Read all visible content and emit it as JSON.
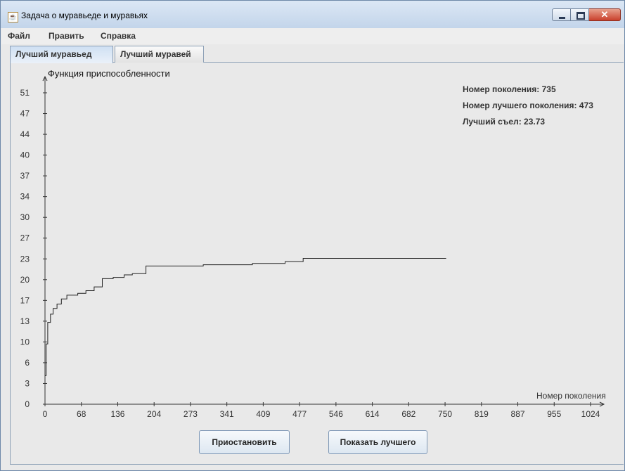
{
  "window": {
    "title": "Задача о муравьеде и муравьях"
  },
  "menu": {
    "items": [
      "Файл",
      "Править",
      "Справка"
    ]
  },
  "tabs": [
    {
      "label": "Лучший муравьед",
      "active": true
    },
    {
      "label": "Лучший муравей",
      "active": false
    }
  ],
  "stats": {
    "generation": "Номер поколения: 735",
    "best_generation": "Номер лучшего поколения: 473",
    "best_eaten": "Лучший съел: 23.73"
  },
  "buttons": {
    "pause": "Приостановить",
    "show_best": "Показать лучшего"
  },
  "chart_data": {
    "type": "line",
    "title": "Функция приспособленности",
    "xlabel": "Номер поколения",
    "ylabel": "",
    "x_ticks": [
      "0",
      "68",
      "136",
      "204",
      "273",
      "341",
      "409",
      "477",
      "546",
      "614",
      "682",
      "750",
      "819",
      "887",
      "955",
      "1024"
    ],
    "y_ticks": [
      "0",
      "3",
      "6",
      "10",
      "13",
      "17",
      "20",
      "23",
      "27",
      "30",
      "34",
      "37",
      "40",
      "44",
      "47",
      "51"
    ],
    "xlim": [
      0,
      1024
    ],
    "ylim": [
      0,
      51
    ],
    "grid": false,
    "series": [
      {
        "name": "",
        "step": true,
        "x": [
          0,
          2,
          5,
          10,
          15,
          22,
          30,
          40,
          60,
          75,
          90,
          105,
          125,
          145,
          160,
          185,
          290,
          380,
          440,
          473,
          735
        ],
        "y": [
          4.5,
          9.5,
          12.9,
          14.2,
          15.1,
          15.8,
          16.6,
          17.2,
          17.5,
          17.9,
          18.5,
          19.8,
          20.0,
          20.4,
          20.6,
          21.8,
          22.0,
          22.2,
          22.5,
          23.0,
          23.0
        ]
      }
    ]
  }
}
